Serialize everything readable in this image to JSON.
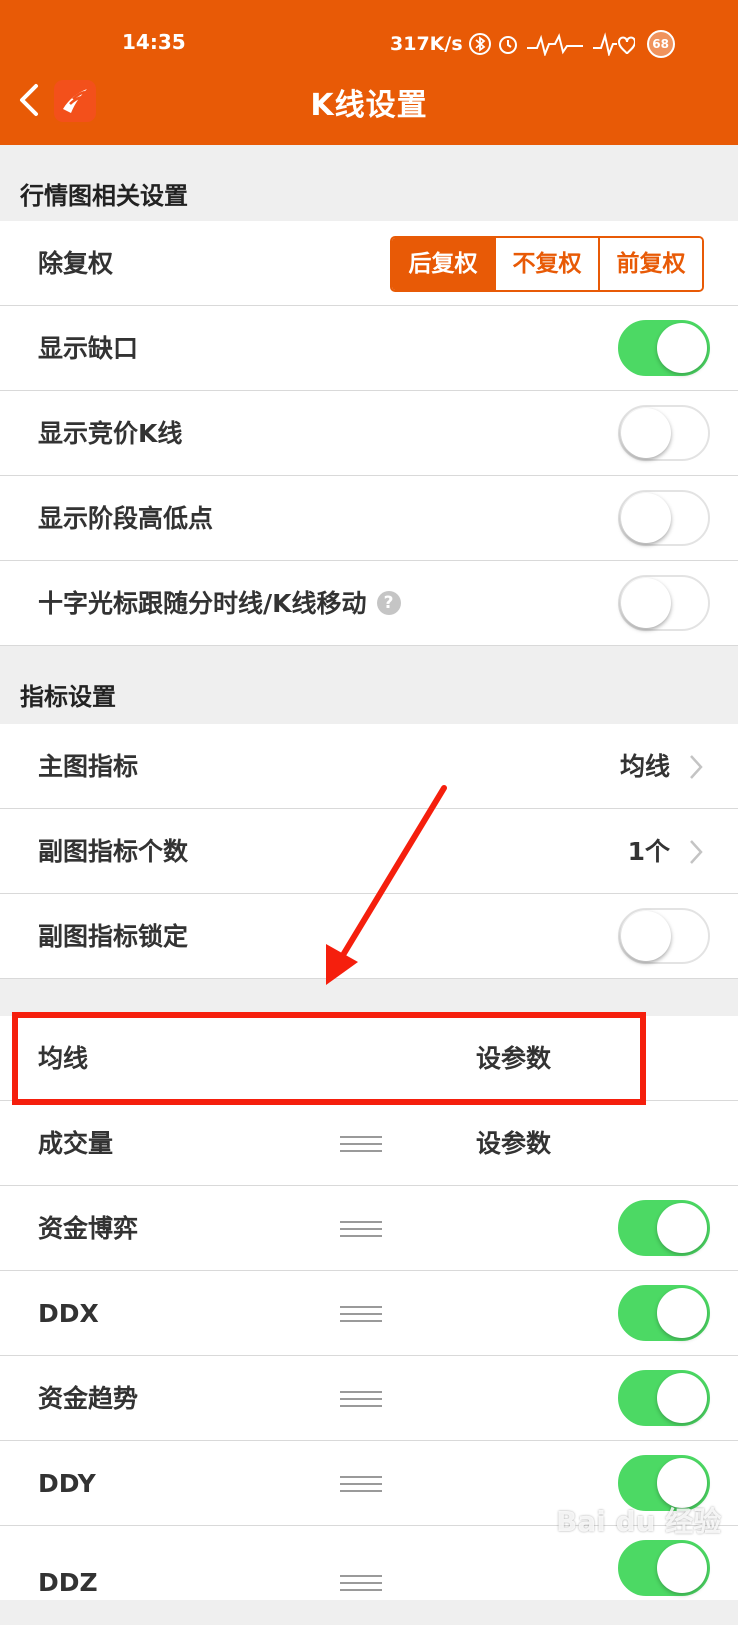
{
  "status_bar": {
    "time": "14:35",
    "network_speed": "317K/s",
    "battery": "68",
    "icons": [
      "bluetooth-icon",
      "alarm-icon",
      "hd-signal-icon",
      "hd-signal-icon"
    ]
  },
  "header": {
    "title": "K线设置",
    "back_icon": "chevron-left-icon",
    "logo_icon": "app-logo-icon",
    "accent_color": "#e85a06"
  },
  "sections": {
    "quote_chart": {
      "title": "行情图相关设置",
      "adjust_label": "除复权",
      "adjust_options": [
        "后复权",
        "不复权",
        "前复权"
      ],
      "adjust_selected": "后复权",
      "rows": [
        {
          "label": "显示缺口",
          "on": true
        },
        {
          "label": "显示竞价K线",
          "on": false
        },
        {
          "label": "显示阶段高低点",
          "on": false
        },
        {
          "label": "十字光标跟随分时线/K线移动",
          "on": false,
          "has_help": true
        }
      ]
    },
    "indicator": {
      "title": "指标设置",
      "main_indicator_label": "主图指标",
      "main_indicator_value": "均线",
      "sub_count_label": "副图指标个数",
      "sub_count_value": "1个",
      "lock_label": "副图指标锁定",
      "lock_on": false
    }
  },
  "indicator_list": [
    {
      "name": "均线",
      "action": "设参数",
      "draggable": false
    },
    {
      "name": "成交量",
      "action": "设参数",
      "draggable": true
    },
    {
      "name": "资金博弈",
      "toggle_on": true,
      "draggable": true
    },
    {
      "name": "DDX",
      "toggle_on": true,
      "draggable": true
    },
    {
      "name": "资金趋势",
      "toggle_on": true,
      "draggable": true
    },
    {
      "name": "DDY",
      "toggle_on": true,
      "draggable": true
    },
    {
      "name": "DDZ",
      "toggle_on": true,
      "draggable": true
    }
  ],
  "colors": {
    "toggle_on": "#4cd964",
    "annotation_red": "#f51f0d"
  },
  "watermark": "Bai du 经验"
}
